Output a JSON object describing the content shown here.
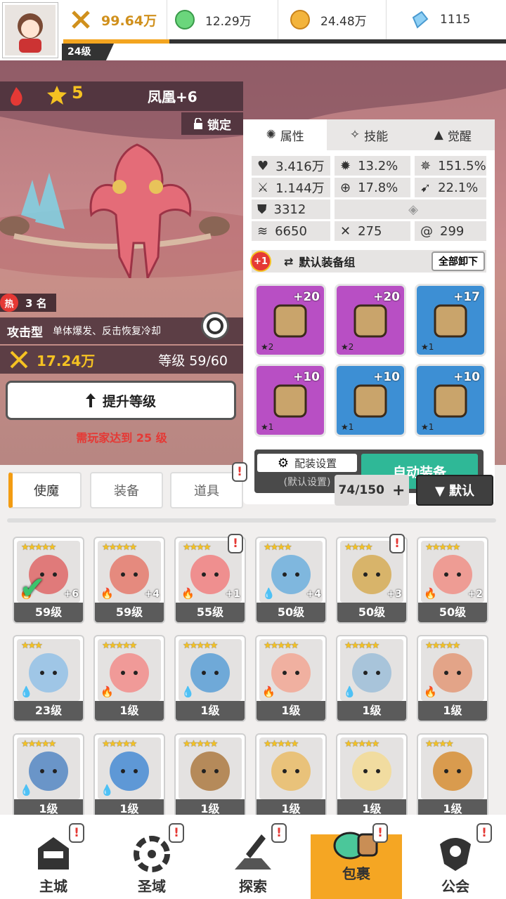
{
  "player": {
    "level": "24级",
    "power": "99.64万"
  },
  "resources": {
    "gems": "12.29万",
    "coins": "24.48万",
    "crystals": "1115"
  },
  "hero": {
    "rarity_stars": "5",
    "name": "凤凰+6",
    "lock_label": "锁定",
    "hot_label": "热",
    "rank": "3 名",
    "role": "攻击型",
    "role_desc": "单体爆发、反击恢复冷却",
    "power": "17.24万",
    "level_label": "等级 59/60",
    "upgrade_label": "提升等级",
    "requirement": "需玩家达到 25 级"
  },
  "panel": {
    "tabs": [
      {
        "label": "属性"
      },
      {
        "label": "技能"
      },
      {
        "label": "觉醒"
      }
    ],
    "stats": {
      "hp": "3.416万",
      "crit": "13.2%",
      "crit_dmg": "151.5%",
      "atk": "1.144万",
      "acc": "17.8%",
      "dodge": "22.1%",
      "def": "3312",
      "spd": "6650",
      "stat_a": "275",
      "stat_b": "299"
    },
    "equip_group_badge": "+1",
    "equip_group": "默认装备组",
    "unequip_all": "全部卸下",
    "equipment": [
      {
        "plus": "+20",
        "stars": "★2",
        "color": "#b84fc4"
      },
      {
        "plus": "+20",
        "stars": "★2",
        "color": "#b84fc4"
      },
      {
        "plus": "+17",
        "stars": "★1",
        "color": "#3d8fd4"
      },
      {
        "plus": "+10",
        "stars": "★1",
        "color": "#b84fc4"
      },
      {
        "plus": "+10",
        "stars": "★1",
        "color": "#3d8fd4"
      },
      {
        "plus": "+10",
        "stars": "★1",
        "color": "#3d8fd4"
      }
    ],
    "config_label": "配装设置",
    "config_sub": "(默认设置)",
    "auto_equip": "自动装备"
  },
  "filters": {
    "tab1": "使魔",
    "tab2": "装备",
    "tab3": "道具",
    "count": "74/150",
    "sort": "▼ 默认"
  },
  "cards": [
    {
      "lv": "59级",
      "stars": "★★★★★",
      "el": "🔥",
      "plus": "+6",
      "color": "#e07a7a"
    },
    {
      "lv": "59级",
      "stars": "★★★★★",
      "el": "🔥",
      "plus": "+4",
      "color": "#e58a7e"
    },
    {
      "lv": "55级",
      "stars": "★★★★",
      "el": "🔥",
      "plus": "+1",
      "color": "#ef8f8f"
    },
    {
      "lv": "50级",
      "stars": "★★★★",
      "el": "💧",
      "plus": "+4",
      "color": "#7fb7de"
    },
    {
      "lv": "50级",
      "stars": "★★★★",
      "el": "",
      "plus": "+3",
      "color": "#d8b46a"
    },
    {
      "lv": "50级",
      "stars": "★★★★★",
      "el": "🔥",
      "plus": "+2",
      "color": "#ee9c94"
    },
    {
      "lv": "23级",
      "stars": "★★★",
      "el": "💧",
      "plus": "",
      "color": "#9fc6e6"
    },
    {
      "lv": "1级",
      "stars": "★★★★★",
      "el": "🔥",
      "plus": "",
      "color": "#f09a98"
    },
    {
      "lv": "1级",
      "stars": "★★★★★",
      "el": "💧",
      "plus": "",
      "color": "#6fa9d8"
    },
    {
      "lv": "1级",
      "stars": "★★★★★",
      "el": "🔥",
      "plus": "",
      "color": "#f0b0a0"
    },
    {
      "lv": "1级",
      "stars": "★★★★★",
      "el": "💧",
      "plus": "",
      "color": "#a8c4da"
    },
    {
      "lv": "1级",
      "stars": "★★★★★",
      "el": "🔥",
      "plus": "",
      "color": "#e3a488"
    },
    {
      "lv": "1级",
      "stars": "★★★★★",
      "el": "💧",
      "plus": "",
      "color": "#6a95c8"
    },
    {
      "lv": "1级",
      "stars": "★★★★★",
      "el": "💧",
      "plus": "",
      "color": "#5e98d6"
    },
    {
      "lv": "1级",
      "stars": "★★★★★",
      "el": "",
      "plus": "",
      "color": "#b58a5a"
    },
    {
      "lv": "1级",
      "stars": "★★★★★",
      "el": "",
      "plus": "",
      "color": "#e9c27a"
    },
    {
      "lv": "1级",
      "stars": "★★★★★",
      "el": "",
      "plus": "",
      "color": "#f1dca0"
    },
    {
      "lv": "1级",
      "stars": "★★★★",
      "el": "",
      "plus": "",
      "color": "#d99b4e"
    }
  ],
  "nav": [
    {
      "label": "主城"
    },
    {
      "label": "圣域"
    },
    {
      "label": "探索"
    },
    {
      "label": "包裹"
    },
    {
      "label": "公会"
    }
  ]
}
